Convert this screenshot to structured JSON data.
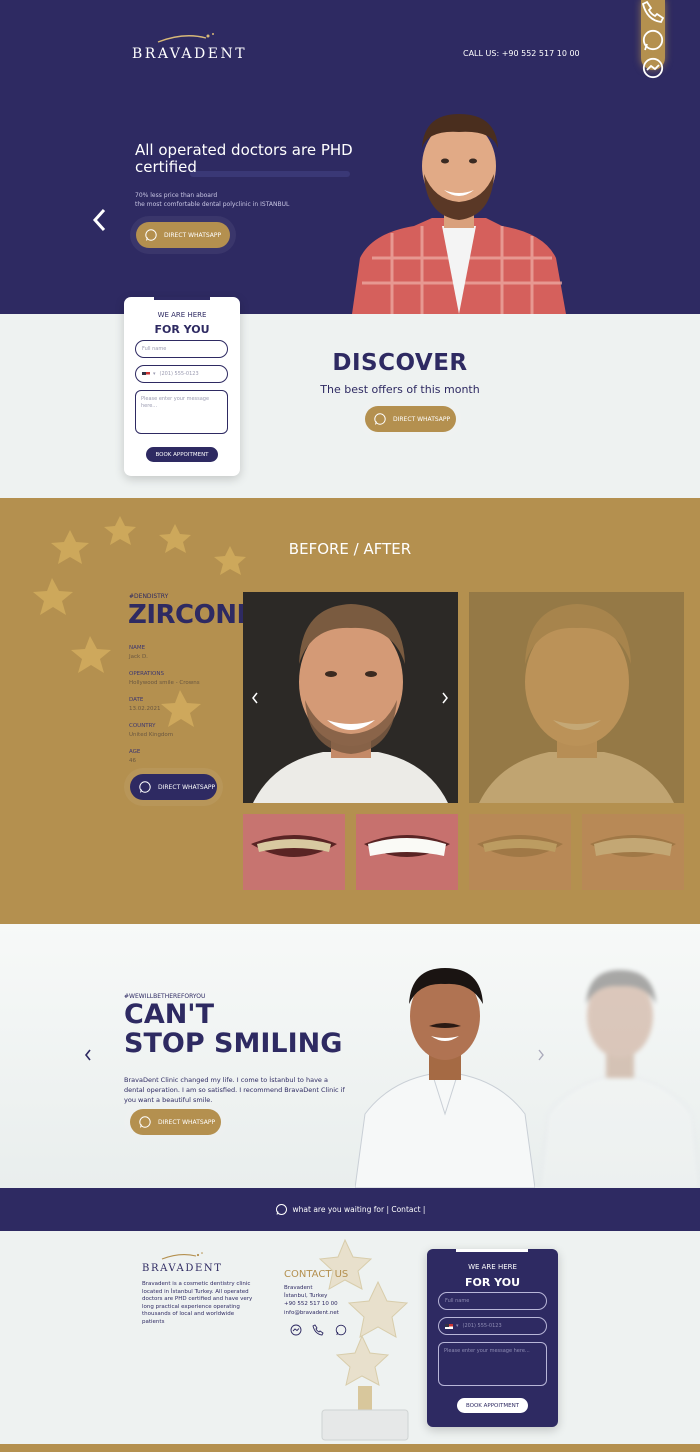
{
  "brand": {
    "name": "BRAVADENT",
    "gold": "#b4904f",
    "navy": "#2e2a62"
  },
  "header": {
    "call_label": "CALL US: +90 552 517 10 00",
    "side_icons": [
      "phone-icon",
      "whatsapp-icon",
      "messenger-icon"
    ]
  },
  "hero": {
    "title": "All operated doctors are PHD certified",
    "sub_line1": "70% less price than aboard",
    "sub_line2": "the most comfortable dental polyclinic in ISTANBUL",
    "cta_label": "DIRECT WHATSAPP"
  },
  "appointment_form": {
    "kicker": "WE ARE HERE",
    "heading": "FOR YOU",
    "name_placeholder": "Full name",
    "phone_placeholder": "(201) 555-0123",
    "message_placeholder": "Please enter your message here...",
    "submit_label": "BOOK APPOITMENT"
  },
  "discover": {
    "title": "DISCOVER",
    "subtitle": "The best offers of this month",
    "cta_label": "DIRECT WHATSAPP"
  },
  "before_after": {
    "title": "BEFORE / AFTER",
    "tag": "#DENDISTRY",
    "treatment": "ZIRCONIUM",
    "meta": [
      {
        "label": "NAME",
        "value": "Jack D."
      },
      {
        "label": "OPERATIONS",
        "value": "Hollywood smile - Crowns"
      },
      {
        "label": "DATE",
        "value": "13.02.2021"
      },
      {
        "label": "COUNTRY",
        "value": "United Kingdom"
      },
      {
        "label": "AGE",
        "value": "46"
      }
    ],
    "cta_label": "DIRECT WHATSAPP"
  },
  "testimonial": {
    "tag": "#WEWILLBETHEREFORYOU",
    "title_line1": "CAN'T",
    "title_line2": "STOP SMILING",
    "quote": "BravaDent Clinic changed my life. I come to İstanbul to have a dental operation. I am so satisfied. I recommend BravaDent Clinic if you want a beautiful smile.",
    "cta_label": "DIRECT WHATSAPP"
  },
  "banner": {
    "text": "what are you waiting for | Contact |"
  },
  "footer": {
    "about": "Bravadent is a cosmetic dentistry clinic located in İstanbul Turkey. All operated doctors are PHD certified and have very long practical experience operating thousands of local and worldwide patients",
    "contact_title": "CONTACT US",
    "contact_lines": [
      "Bravadent",
      "İstanbul, Turkey",
      "+90 552 517 10 00",
      "info@bravadent.net"
    ],
    "form": {
      "kicker": "WE ARE HERE",
      "heading": "FOR YOU",
      "name_placeholder": "Full name",
      "phone_placeholder": "(201) 555-0123",
      "message_placeholder": "Please enter your message here...",
      "submit_label": "BOOK APPOITMENT"
    }
  }
}
